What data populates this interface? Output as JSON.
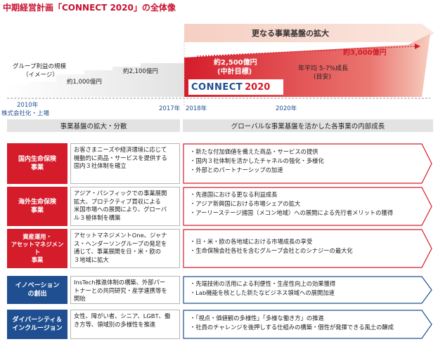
{
  "title": "中期経営計画「CONNECT 2020」の全体像",
  "chart_top": {
    "banner": "更なる事業基盤の拡大",
    "ylabel_line1": "グループ利益の規模",
    "ylabel_line2": "（イメージ）",
    "label_1000": "約1,000億円",
    "label_2100": "約2,100億円",
    "label_2500_line1": "約2,500億円",
    "label_2500_line2": "(中計目標)",
    "label_3000": "約3,000億円",
    "growth_line1": "年平均 5-7%成長",
    "growth_line2": "(目安)",
    "year_2010": "2010年",
    "year_2010_sub": "株式会社化・上場",
    "year_2017": "2017年",
    "year_2018": "2018年",
    "year_2020": "2020年",
    "logo_text": "CONNECT",
    "logo_year": "2020"
  },
  "headers": {
    "left": "事業基盤の拡大・分散",
    "right": "グローバルな事業基盤を活かした各事業の内部成長"
  },
  "rows": [
    {
      "category_lines": [
        "国内生命保険",
        "事業"
      ],
      "desc_lines": [
        "お客さまニーズや経済環境に応じて",
        "機動的に商品・サービスを提供する",
        "国内３社体制を確立"
      ],
      "bullets": [
        "・新たな付加価値を備えた商品・サービスの提供",
        "・国内３社体制を活かしたチャネルの強化・多様化",
        "・外部とのパートナーシップの加速"
      ]
    },
    {
      "category_lines": [
        "海外生命保険",
        "事業"
      ],
      "desc_lines": [
        "アジア・パシフィックでの事業展開",
        "拡大、プロテクティブ買収による",
        "米国市場への展開により、グローバ",
        "ル３極体制を構築"
      ],
      "bullets": [
        "・先進国における更なる利益成長",
        "・アジア新興国における市場シェアの拡大",
        "・アーリーステージ諸国（メコン地域）への展開による先行者メリットの獲得"
      ]
    },
    {
      "category_lines": [
        "資産運用・",
        "アセットマネジメント",
        "事業"
      ],
      "desc_lines": [
        "アセットマネジメントOne、ジャナ",
        "ス・ヘンダーソングループの発足を",
        "通じて、事業展開を日・米・欧の",
        "３地域に拡大"
      ],
      "bullets": [
        "・日・米・欧の各地域における市場成長の享受",
        "・生命保険会社各社を含むグループ会社とのシナジーの最大化"
      ]
    },
    {
      "category_lines": [
        "イノベーション",
        "の創出"
      ],
      "desc_lines": [
        "InsTech推進体制の構築、外部パー",
        "トナーとの共同研究・産学連携等を",
        "開始"
      ],
      "bullets": [
        "・先端技術の活用による利便性・生産性向上の効果獲得",
        "・Lab機能を核とした新たなビジネス領域への展開加速"
      ]
    },
    {
      "category_lines": [
        "ダイバーシティ＆",
        "インクルージョン"
      ],
      "desc_lines": [
        "女性、障がい者、シニア、LGBT、働",
        "き方等、領域別の多様性を推進"
      ],
      "bullets": [
        "・「視点・価値観の多様性」「多様な働き方」の推進",
        "・社員のチャレンジを後押しする仕組みの構築・個性が発揮できる風土の醸成"
      ]
    }
  ],
  "colors": {
    "accent_red": "#d51c2a",
    "accent_blue": "#1f4f91",
    "title_red": "#c8102e"
  }
}
